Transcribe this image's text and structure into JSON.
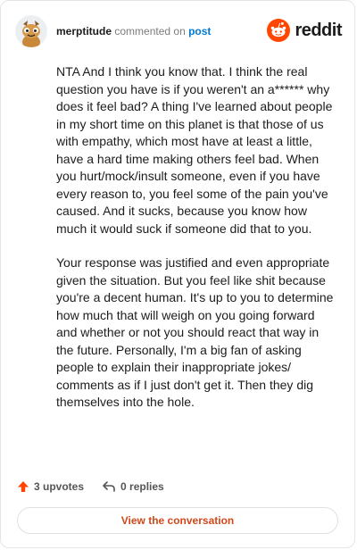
{
  "comment": {
    "username": "merptitude",
    "action_text": "commented on",
    "post_link": "post",
    "paragraphs": [
      "NTA And I think you know that. I think the real question you have is if you weren't an a****** why does it feel bad? A thing I've learned about people in my short time on this planet is that those of us with empathy, which most have at least a little, have a hard time making others feel bad. When you hurt/mock/insult someone, even if you have every reason to, you feel some of the pain you've caused. And it sucks, because you know how much it would suck if someone did that to you.",
      "Your response was justified and even appropriate given the situation. But you feel like shit because you're a decent human. It's up to you to determine how much that will weigh on you going forward and whether or not you should react that way in the future. Personally, I'm a big fan of asking people to explain their inappropriate jokes/ comments as if I just don't get it. Then they dig themselves into the hole."
    ],
    "upvotes_label": "3 upvotes",
    "replies_label": "0 replies"
  },
  "brand": {
    "wordmark": "reddit",
    "icon": "reddit-logo-icon",
    "color": "#ff4500"
  },
  "cta": {
    "label": "View the conversation"
  },
  "colors": {
    "accent": "#d1481a",
    "link": "#0079d3",
    "upvote": "#ff4500"
  }
}
